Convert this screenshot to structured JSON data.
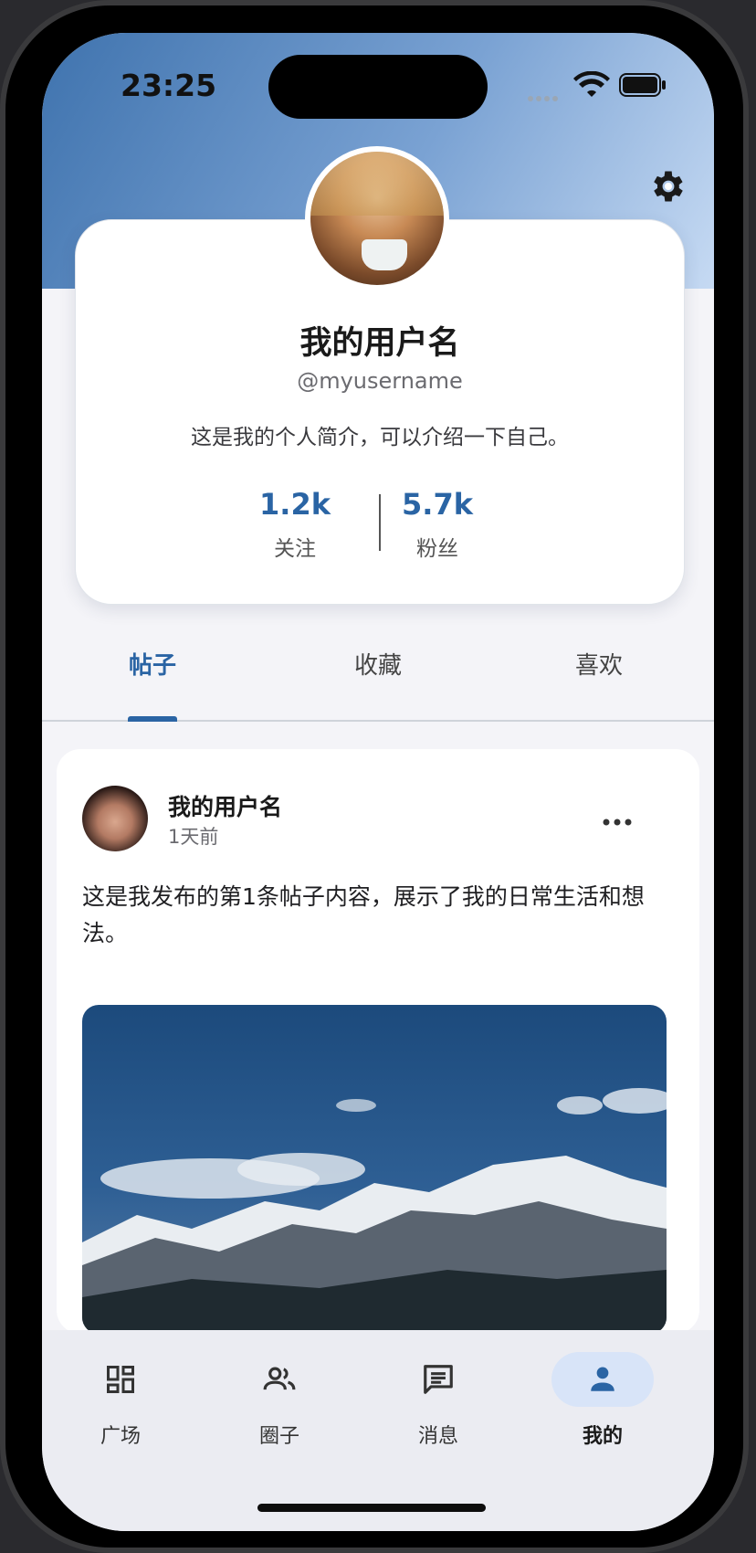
{
  "status_bar": {
    "time": "23:25"
  },
  "profile": {
    "display_name": "我的用户名",
    "handle": "@myusername",
    "bio": "这是我的个人简介，可以介绍一下自己。",
    "following_count": "1.2k",
    "following_label": "关注",
    "followers_count": "5.7k",
    "followers_label": "粉丝"
  },
  "tabs": [
    {
      "label": "帖子",
      "active": true
    },
    {
      "label": "收藏",
      "active": false
    },
    {
      "label": "喜欢",
      "active": false
    }
  ],
  "post": {
    "author": "我的用户名",
    "time": "1天前",
    "content": "这是我发布的第1条帖子内容，展示了我的日常生活和想法。"
  },
  "bottom_nav": [
    {
      "label": "广场",
      "icon": "dashboard-icon"
    },
    {
      "label": "圈子",
      "icon": "people-icon"
    },
    {
      "label": "消息",
      "icon": "message-icon"
    },
    {
      "label": "我的",
      "icon": "person-icon",
      "active": true
    }
  ],
  "colors": {
    "accent": "#2a64a4",
    "active_nav_bg": "#d8e4f8"
  }
}
